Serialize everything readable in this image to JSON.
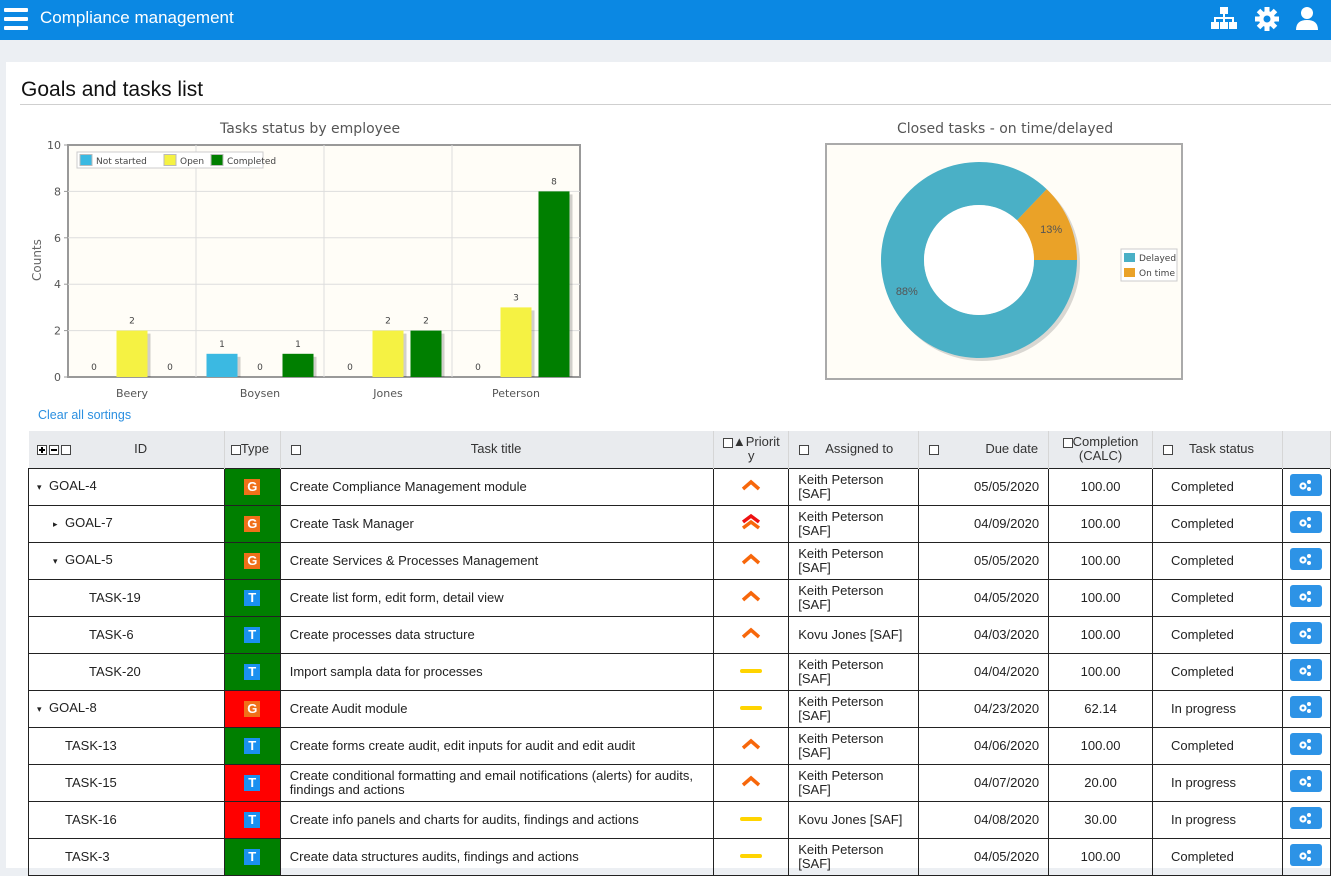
{
  "header": {
    "app_title": "Compliance management",
    "icons": [
      "menu-icon",
      "sitemap-icon",
      "gear-icon",
      "user-icon"
    ]
  },
  "page": {
    "title": "Goals and tasks list",
    "clear_sortings": "Clear all sortings"
  },
  "colors": {
    "topbar": "#0b88e3",
    "not_started": "#3bb9e2",
    "open": "#f5f243",
    "completed": "#007f00",
    "delayed": "#4ab0c6",
    "on_time": "#eaa228",
    "row_green": "#007f00",
    "row_red": "#ff0000",
    "action_button": "#2d93e6"
  },
  "chart_data": [
    {
      "type": "bar",
      "title": "Tasks status by employee",
      "xlabel": "",
      "ylabel": "Counts",
      "ylim": [
        0,
        10
      ],
      "yticks": [
        "0",
        "2",
        "4",
        "6",
        "8",
        "10"
      ],
      "categories": [
        "Beery",
        "Boysen",
        "Jones",
        "Peterson"
      ],
      "series": [
        {
          "name": "Not started",
          "color": "#3bb9e2",
          "values": [
            0,
            1,
            0,
            0
          ]
        },
        {
          "name": "Open",
          "color": "#f5f243",
          "values": [
            2,
            0,
            2,
            3
          ]
        },
        {
          "name": "Completed",
          "color": "#007f00",
          "values": [
            0,
            1,
            2,
            8
          ]
        }
      ],
      "legend": "top-left",
      "grid": true
    },
    {
      "type": "pie",
      "title": "Closed tasks - on time/delayed",
      "donut": true,
      "slices": [
        {
          "label": "Delayed",
          "value": 88,
          "display": "88%",
          "color": "#4ab0c6"
        },
        {
          "label": "On time",
          "value": 13,
          "display": "13%",
          "color": "#eaa228"
        }
      ],
      "legend": "right"
    }
  ],
  "table": {
    "columns": {
      "id": "ID",
      "type": "Type",
      "title": "Task title",
      "priority": "Priority",
      "priority_sort": "▲",
      "assigned": "Assigned to",
      "due": "Due date",
      "completion": "Completion (CALC)",
      "status": "Task status"
    },
    "rows": [
      {
        "id": "GOAL-4",
        "level": 0,
        "caret": "down",
        "type": "G",
        "type_color": "green",
        "title": "Create Compliance Management module",
        "priority": "high",
        "assigned": "Keith Peterson [SAF]",
        "due": "05/05/2020",
        "completion": "100.00",
        "status": "Completed"
      },
      {
        "id": "GOAL-7",
        "level": 1,
        "caret": "right",
        "type": "G",
        "type_color": "green",
        "title": "Create Task Manager",
        "priority": "highest",
        "assigned": "Keith Peterson [SAF]",
        "due": "04/09/2020",
        "completion": "100.00",
        "status": "Completed"
      },
      {
        "id": "GOAL-5",
        "level": 1,
        "caret": "down",
        "type": "G",
        "type_color": "green",
        "title": "Create Services & Processes Management",
        "priority": "high",
        "assigned": "Keith Peterson [SAF]",
        "due": "05/05/2020",
        "completion": "100.00",
        "status": "Completed"
      },
      {
        "id": "TASK-19",
        "level": 2,
        "caret": "",
        "type": "T",
        "type_color": "green",
        "title": "Create list form, edit form, detail view",
        "priority": "high",
        "assigned": "Keith Peterson [SAF]",
        "due": "04/05/2020",
        "completion": "100.00",
        "status": "Completed"
      },
      {
        "id": "TASK-6",
        "level": 2,
        "caret": "",
        "type": "T",
        "type_color": "green",
        "title": "Create processes data structure",
        "priority": "high",
        "assigned": "Kovu Jones [SAF]",
        "due": "04/03/2020",
        "completion": "100.00",
        "status": "Completed"
      },
      {
        "id": "TASK-20",
        "level": 2,
        "caret": "",
        "type": "T",
        "type_color": "green",
        "title": "Import sampla data for processes",
        "priority": "medium",
        "assigned": "Keith Peterson [SAF]",
        "due": "04/04/2020",
        "completion": "100.00",
        "status": "Completed"
      },
      {
        "id": "GOAL-8",
        "level": 0,
        "caret": "down",
        "type": "G",
        "type_color": "red",
        "title": "Create Audit module",
        "priority": "medium",
        "assigned": "Keith Peterson [SAF]",
        "due": "04/23/2020",
        "completion": "62.14",
        "status": "In progress"
      },
      {
        "id": "TASK-13",
        "level": 1,
        "caret": "",
        "type": "T",
        "type_color": "green",
        "title": "Create forms create audit, edit inputs for audit and edit audit",
        "priority": "high",
        "assigned": "Keith Peterson [SAF]",
        "due": "04/06/2020",
        "completion": "100.00",
        "status": "Completed"
      },
      {
        "id": "TASK-15",
        "level": 1,
        "caret": "",
        "type": "T",
        "type_color": "red",
        "title": "Create conditional formatting and email notifications (alerts) for audits, findings and actions",
        "priority": "high",
        "assigned": "Keith Peterson [SAF]",
        "due": "04/07/2020",
        "completion": "20.00",
        "status": "In progress"
      },
      {
        "id": "TASK-16",
        "level": 1,
        "caret": "",
        "type": "T",
        "type_color": "red",
        "title": "Create info panels and charts for audits, findings and actions",
        "priority": "medium",
        "assigned": "Kovu Jones [SAF]",
        "due": "04/08/2020",
        "completion": "30.00",
        "status": "In progress"
      },
      {
        "id": "TASK-3",
        "level": 1,
        "caret": "",
        "type": "T",
        "type_color": "green",
        "title": "Create data structures audits, findings and actions",
        "priority": "medium",
        "assigned": "Keith Peterson [SAF]",
        "due": "04/05/2020",
        "completion": "100.00",
        "status": "Completed"
      }
    ]
  }
}
